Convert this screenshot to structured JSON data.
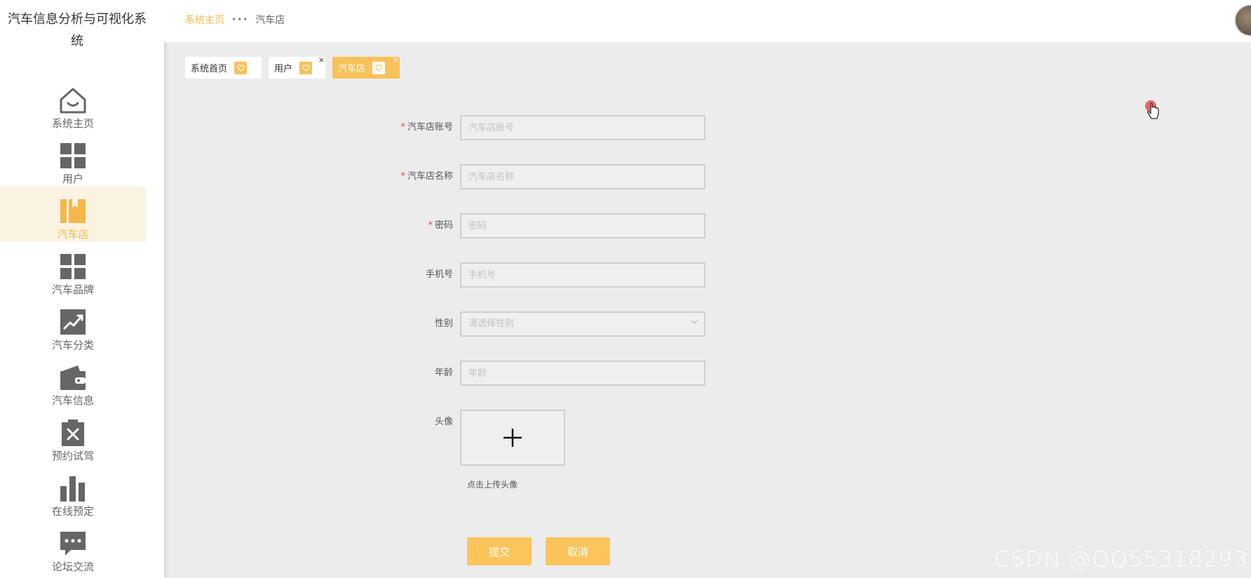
{
  "app": {
    "title_line1": "汽车信息分析与可视化系",
    "title_line2": "统"
  },
  "sidebar": {
    "items": [
      {
        "label": "系统主页",
        "icon": "house-icon"
      },
      {
        "label": "用户",
        "icon": "grid-icon"
      },
      {
        "label": "汽车店",
        "icon": "book-icon",
        "active": true
      },
      {
        "label": "汽车品牌",
        "icon": "grid-icon"
      },
      {
        "label": "汽车分类",
        "icon": "chart-line-icon"
      },
      {
        "label": "汽车信息",
        "icon": "wallet-icon"
      },
      {
        "label": "预约试驾",
        "icon": "clipboard-x-icon"
      },
      {
        "label": "在线预定",
        "icon": "bar-chart-icon"
      },
      {
        "label": "论坛交流",
        "icon": "chat-icon"
      }
    ]
  },
  "header": {
    "breadcrumb_home": "系统主页",
    "breadcrumb_separator": "•••",
    "breadcrumb_current": "汽车店"
  },
  "tabs": [
    {
      "label": "系统首页",
      "closable": false,
      "active": false
    },
    {
      "label": "用户",
      "closable": true,
      "active": false
    },
    {
      "label": "汽车店",
      "closable": true,
      "active": true
    }
  ],
  "tab_close_glyph": "×",
  "form": {
    "required_mark": "*",
    "fields": {
      "account": {
        "label": "汽车店账号",
        "placeholder": "汽车店账号",
        "required": true
      },
      "name": {
        "label": "汽车店名称",
        "placeholder": "汽车店名称",
        "required": true
      },
      "password": {
        "label": "密码",
        "placeholder": "密码",
        "required": true
      },
      "phone": {
        "label": "手机号",
        "placeholder": "手机号"
      },
      "gender": {
        "label": "性别",
        "placeholder": "请选择性别"
      },
      "age": {
        "label": "年龄",
        "placeholder": "年龄"
      },
      "avatar": {
        "label": "头像",
        "upload_tip": "点击上传头像"
      }
    },
    "submit_label": "提交",
    "cancel_label": "取消"
  },
  "colors": {
    "accent": "#f9c15a",
    "active_bg": "#fbf3e2",
    "required": "#e74c3c"
  },
  "watermark": "CSDN @QQ55318293"
}
